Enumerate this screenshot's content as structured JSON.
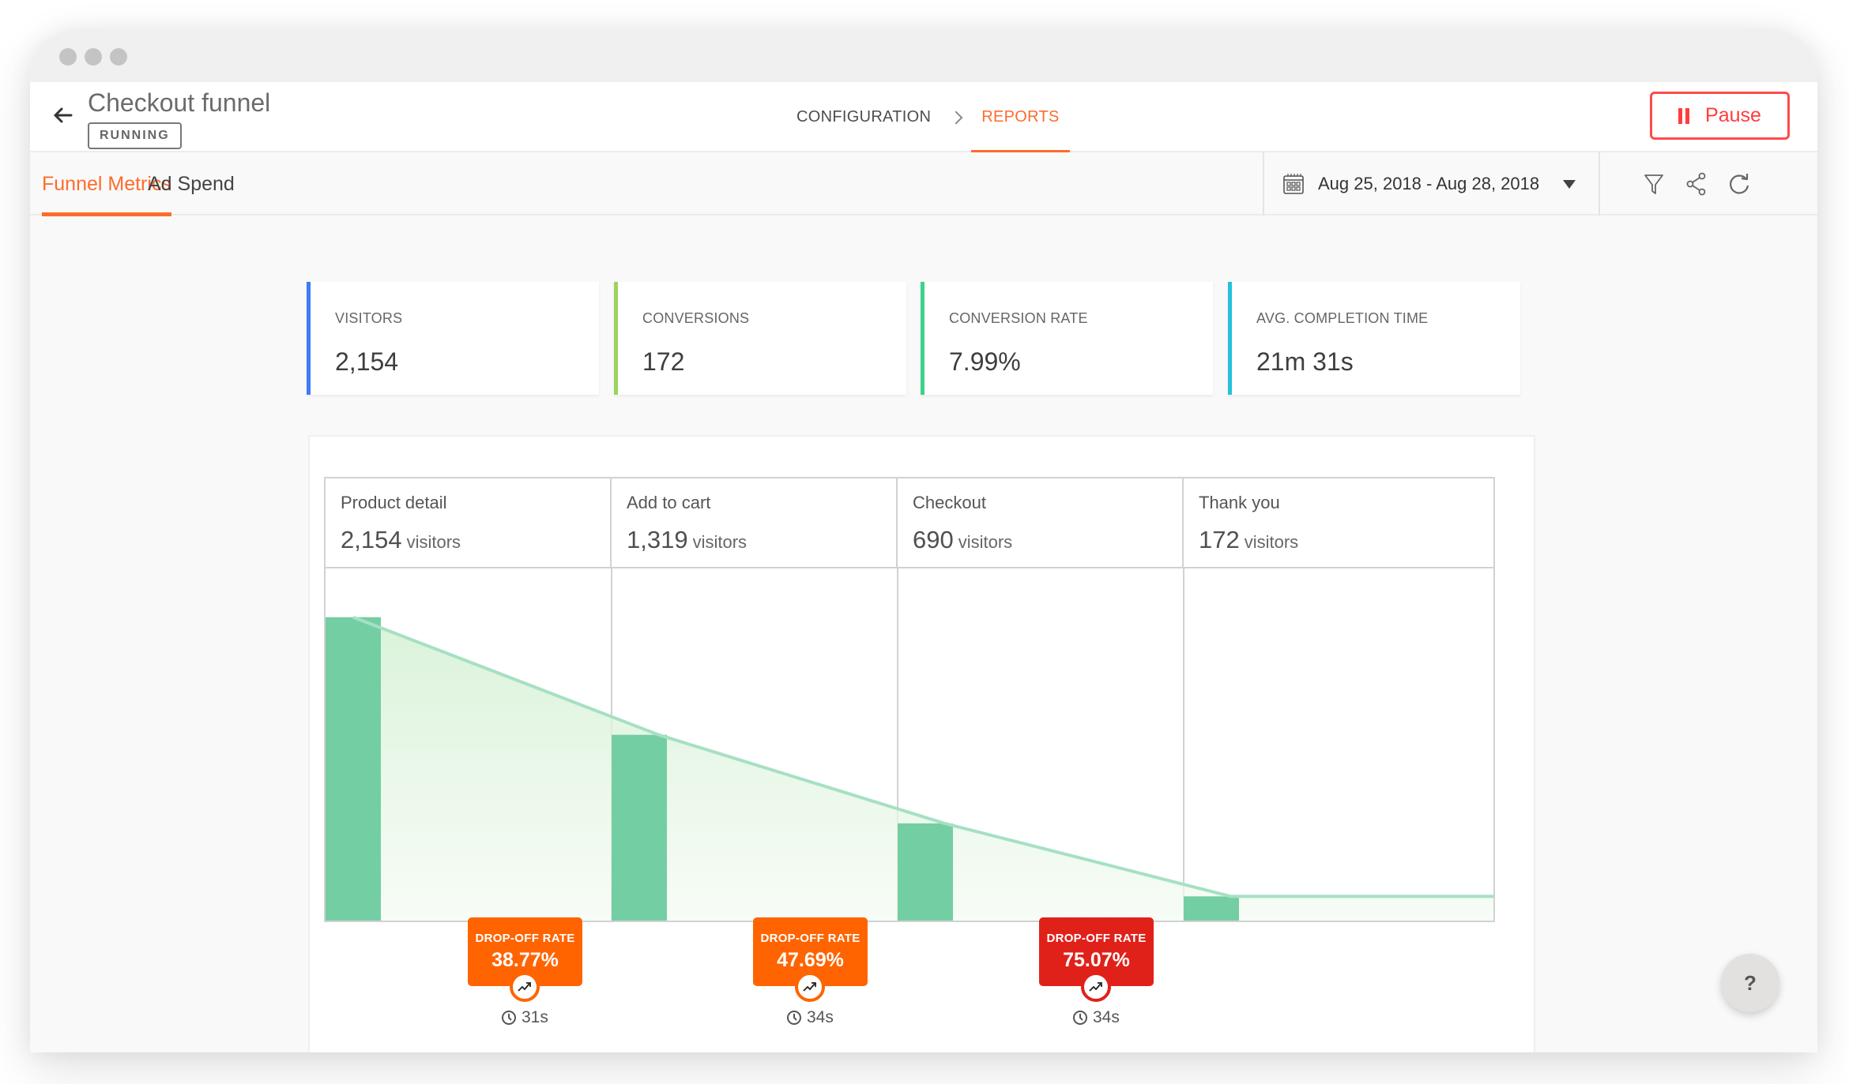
{
  "window": {
    "controls": [
      "dot",
      "dot",
      "dot"
    ]
  },
  "header": {
    "title": "Checkout funnel",
    "status": "RUNNING",
    "breadcrumb": [
      {
        "label": "CONFIGURATION",
        "active": false
      },
      {
        "label": "REPORTS",
        "active": true
      }
    ],
    "pause_label": "Pause"
  },
  "tabs": [
    {
      "label": "Funnel Metrics",
      "active": true
    },
    {
      "label": "Ad Spend",
      "active": false
    }
  ],
  "toolbar": {
    "date_range": "Aug 25, 2018 - Aug 28, 2018",
    "icons": [
      "calendar-icon",
      "filter-icon",
      "share-icon",
      "refresh-icon"
    ]
  },
  "metrics": [
    {
      "label": "VISITORS",
      "value": "2,154",
      "color": "#3d7bf7"
    },
    {
      "label": "CONVERSIONS",
      "value": "172",
      "color": "#9dd45a"
    },
    {
      "label": "CONVERSION RATE",
      "value": "7.99%",
      "color": "#3cd28b"
    },
    {
      "label": "AVG. COMPLETION TIME",
      "value": "21m 31s",
      "color": "#26c2dc"
    }
  ],
  "funnel": {
    "unit": "visitors",
    "steps": [
      {
        "name": "Product detail",
        "count": "2,154"
      },
      {
        "name": "Add to cart",
        "count": "1,319"
      },
      {
        "name": "Checkout",
        "count": "690"
      },
      {
        "name": "Thank you",
        "count": "172"
      }
    ],
    "dropoffs": [
      {
        "label": "DROP-OFF RATE",
        "value": "38.77%",
        "time": "31s",
        "color": "#ff6400"
      },
      {
        "label": "DROP-OFF RATE",
        "value": "47.69%",
        "time": "34s",
        "color": "#ff6400"
      },
      {
        "label": "DROP-OFF RATE",
        "value": "75.07%",
        "time": "34s",
        "color": "#e0211a"
      }
    ],
    "bar_color": "#74cea3"
  },
  "chart_data": {
    "type": "bar",
    "title": "",
    "categories": [
      "Product detail",
      "Add to cart",
      "Checkout",
      "Thank you"
    ],
    "values": [
      2154,
      1319,
      690,
      172
    ],
    "xlabel": "",
    "ylabel": "visitors",
    "ylim": [
      0,
      2500
    ],
    "grid": false,
    "legend": "none",
    "annotations": [
      {
        "between": [
          "Product detail",
          "Add to cart"
        ],
        "text": "DROP-OFF RATE 38.77%",
        "time": "31s"
      },
      {
        "between": [
          "Add to cart",
          "Checkout"
        ],
        "text": "DROP-OFF RATE 47.69%",
        "time": "34s"
      },
      {
        "between": [
          "Checkout",
          "Thank you"
        ],
        "text": "DROP-OFF RATE 75.07%",
        "time": "34s"
      }
    ]
  },
  "help": {
    "label": "?"
  }
}
